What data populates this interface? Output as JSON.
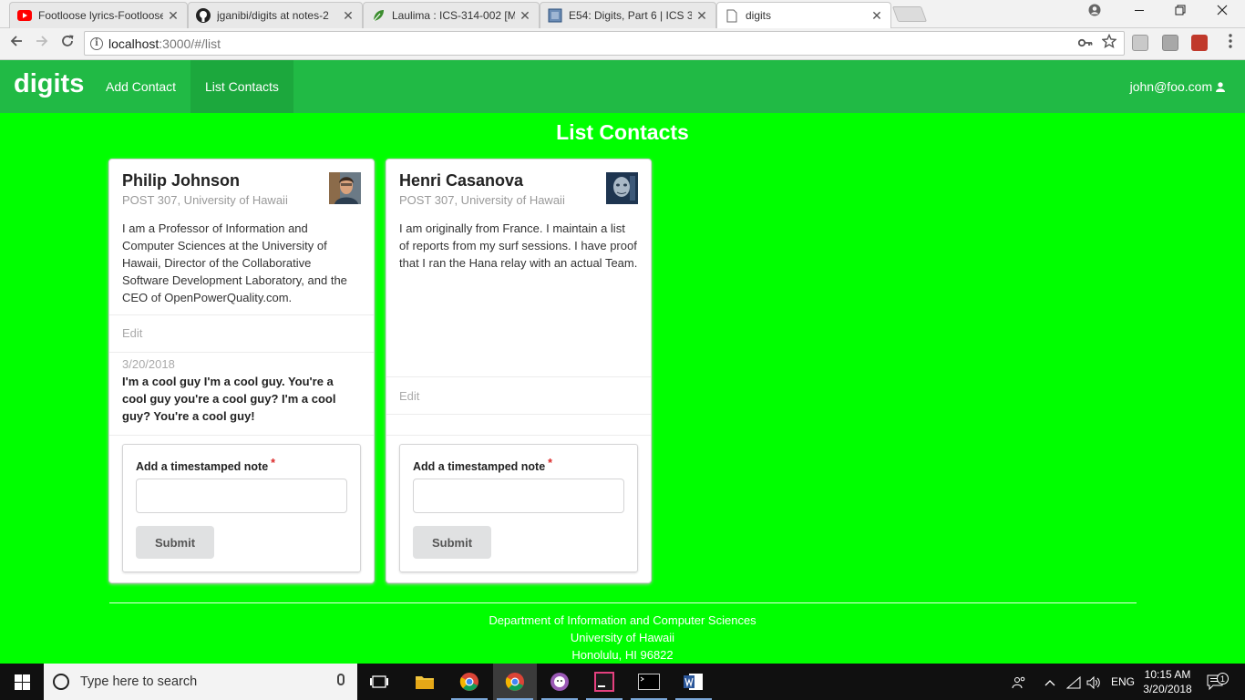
{
  "browser": {
    "tabs": [
      {
        "title": "Footloose lyrics-Footloose",
        "favicon": "youtube-icon",
        "active": false
      },
      {
        "title": "jganibi/digits at notes-2",
        "favicon": "github-icon",
        "active": false
      },
      {
        "title": "Laulima : ICS-314-002 [M",
        "favicon": "laulima-icon",
        "active": false
      },
      {
        "title": "E54: Digits, Part 6 | ICS 3",
        "favicon": "page-icon",
        "active": false
      },
      {
        "title": "digits",
        "favicon": "blank-page-icon",
        "active": true
      }
    ],
    "close_glyph": "✕",
    "url_host": "localhost",
    "url_path": ":3000/#/list"
  },
  "app": {
    "brand": "digits",
    "nav": {
      "add_contact": "Add Contact",
      "list_contacts": "List Contacts"
    },
    "user": "john@foo.com"
  },
  "page_title": "List Contacts",
  "contacts": [
    {
      "name": "Philip Johnson",
      "address": "POST 307, University of Hawaii",
      "description": "I am a Professor of Information and Computer Sciences at the University of Hawaii, Director of the Collaborative Software Development Laboratory, and the CEO of OpenPowerQuality.com.",
      "edit": "Edit",
      "notes": [
        {
          "date": "3/20/2018",
          "text": "I'm a cool guy I'm a cool guy. You're a cool guy you're a cool guy? I'm a cool guy? You're a cool guy!"
        }
      ],
      "form_label": "Add a timestamped note",
      "required_mark": "*",
      "submit": "Submit"
    },
    {
      "name": "Henri Casanova",
      "address": "POST 307, University of Hawaii",
      "description": "I am originally from France. I maintain a list of reports from my surf sessions. I have proof that I ran the Hana relay with an actual Team.",
      "edit": "Edit",
      "notes": [],
      "form_label": "Add a timestamped note",
      "required_mark": "*",
      "submit": "Submit"
    }
  ],
  "footer": {
    "line1": "Department of Information and Computer Sciences",
    "line2": "University of Hawaii",
    "line3": "Honolulu, HI 96822"
  },
  "taskbar": {
    "search_placeholder": "Type here to search",
    "language": "ENG",
    "time": "10:15 AM",
    "date": "3/20/2018",
    "notification_count": "1"
  },
  "colors": {
    "page_bg": "#00ff00",
    "navbar": "#21ba45",
    "navbar_active": "#1ca83d"
  }
}
